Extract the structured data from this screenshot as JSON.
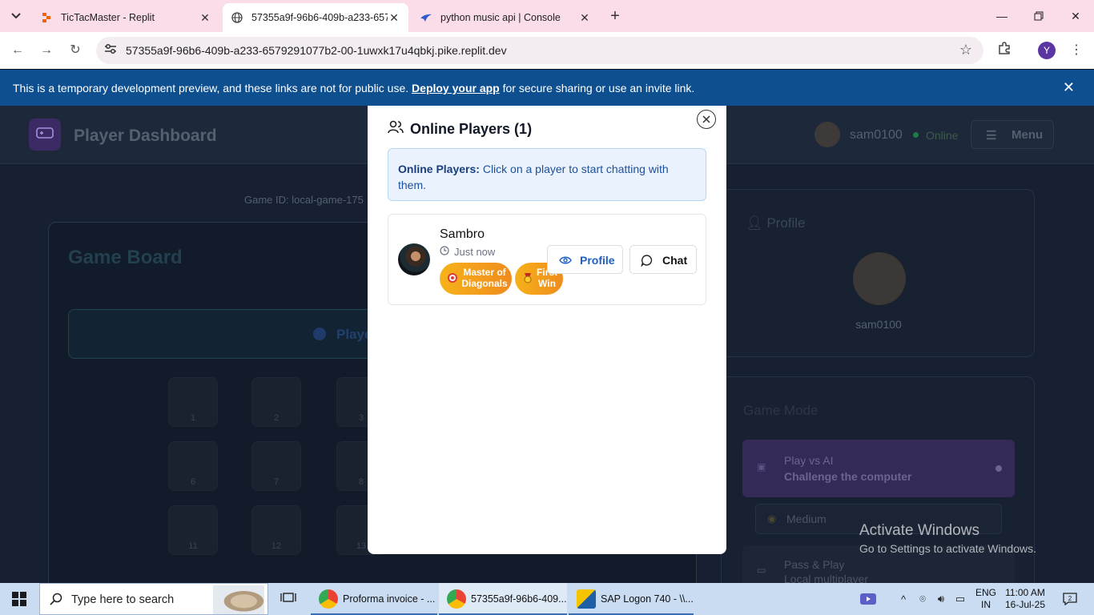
{
  "browser": {
    "tabs": [
      {
        "title": "TicTacMaster - Replit",
        "active": false
      },
      {
        "title": "57355a9f-96b6-409b-a233-657",
        "active": true
      },
      {
        "title": "python music api | Console",
        "active": false
      }
    ],
    "url": "57355a9f-96b6-409b-a233-6579291077b2-00-1uwxk17u4qbkj.pike.replit.dev",
    "profile_initial": "Y"
  },
  "banner": {
    "text_before": "This is a temporary development preview, and these links are not for public use. ",
    "link": "Deploy your app",
    "text_after": " for secure sharing or use an invite link."
  },
  "app": {
    "title": "Player Dashboard",
    "username": "sam0100",
    "status": "Online",
    "menu_label": "Menu",
    "game_id": "Game ID: local-game-175",
    "board_title": "Game Board",
    "player_bar_label": "Playe",
    "cells": [
      "1",
      "2",
      "3",
      "6",
      "7",
      "8",
      "11",
      "12",
      "13"
    ],
    "profile_heading": "Profile",
    "profile_name": "sam0100",
    "mode_heading": "Game Mode",
    "mode_ai_title": "Play vs AI",
    "mode_ai_desc": "Challenge the computer",
    "difficulty": "Medium",
    "mode_pp_title": "Pass & Play",
    "mode_pp_desc": "Local multiplayer"
  },
  "modal": {
    "title": "Online Players (1)",
    "info_bold": "Online Players:",
    "info_text": " Click on a player to start chatting with them.",
    "players": [
      {
        "name": "Sambro",
        "last_seen": "Just now",
        "badges": [
          "Master of Diagonals",
          "First Win"
        ],
        "profile_label": "Profile",
        "chat_label": "Chat"
      }
    ]
  },
  "watermark": {
    "line1": "Activate Windows",
    "line2": "Go to Settings to activate Windows."
  },
  "taskbar": {
    "search_placeholder": "Type here to search",
    "apps": [
      {
        "label": "Proforma invoice - ..."
      },
      {
        "label": "57355a9f-96b6-409..."
      },
      {
        "label": "SAP Logon 740 - \\\\..."
      }
    ],
    "lang1": "ENG",
    "lang2": "IN",
    "time": "11:00 AM",
    "date": "16-Jul-25"
  },
  "colors": {
    "banner": "#0e4f8f",
    "badge_orange": "#f6a91b",
    "link_blue": "#1e5fc7"
  }
}
